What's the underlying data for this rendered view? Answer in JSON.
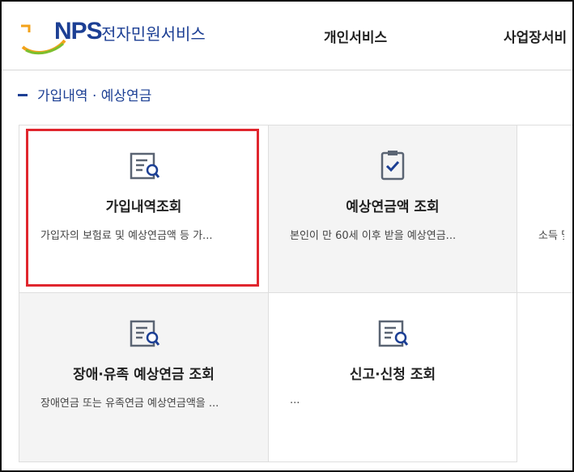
{
  "header": {
    "logo_text": "NPS",
    "logo_sub": "전자민원서비스",
    "nav": [
      "개인서비스",
      "사업장서비"
    ]
  },
  "section": {
    "title": "가입내역 · 예상연금"
  },
  "cards": [
    {
      "title": "가입내역조회",
      "desc": "가입자의 보험료 및 예상연금액 등 가...",
      "icon": "document-search-icon"
    },
    {
      "title": "예상연금액 조회",
      "desc": "본인이 만 60세 이후 받을 예상연금...",
      "icon": "clipboard-check-icon"
    },
    {
      "title": "",
      "desc": "소득 및",
      "icon": ""
    },
    {
      "title": "장애·유족 예상연금 조회",
      "desc": "장애연금 또는 유족연금 예상연금액을 ...",
      "icon": "document-search-icon"
    },
    {
      "title": "신고·신청 조회",
      "desc": "...",
      "icon": "document-search-icon"
    }
  ],
  "colors": {
    "brand": "#1c3f94",
    "highlight": "#e0262e",
    "card_gray": "#f4f4f4"
  }
}
